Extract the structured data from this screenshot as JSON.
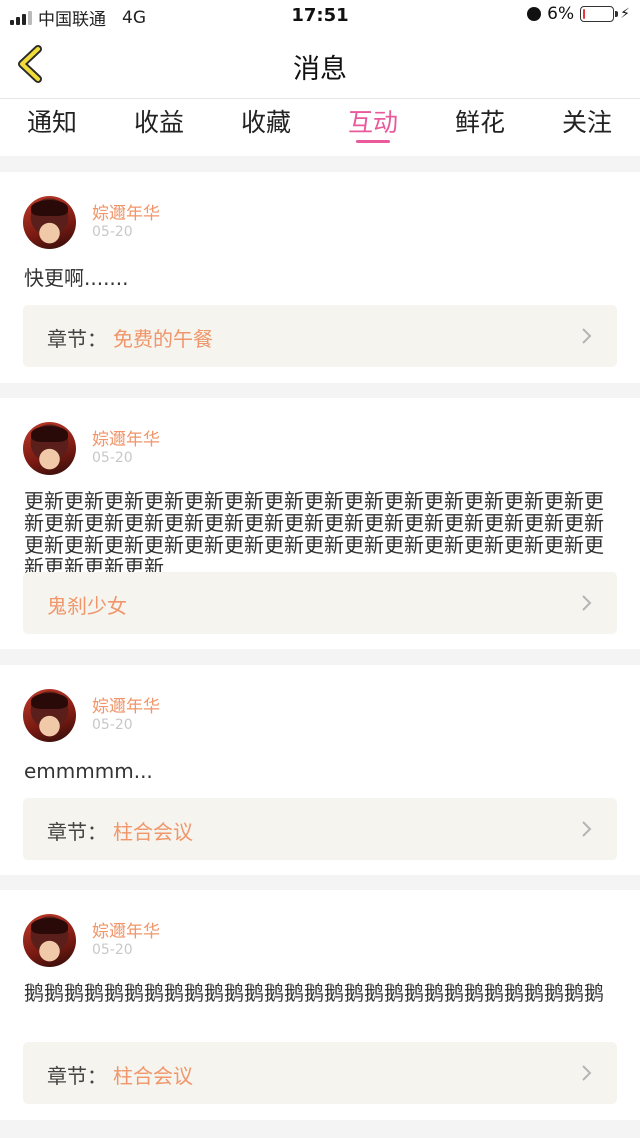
{
  "status_bar": {
    "carrier": "中国联通",
    "network": "4G",
    "time": "17:51",
    "battery": "6%",
    "battery_level": 0.06
  },
  "nav": {
    "title": "消息"
  },
  "tabs": [
    {
      "label": "通知"
    },
    {
      "label": "收益"
    },
    {
      "label": "收藏"
    },
    {
      "label": "互动",
      "active": true
    },
    {
      "label": "鲜花"
    },
    {
      "label": "关注"
    }
  ],
  "posts": [
    {
      "user": "婃邇年华",
      "date": "05-20",
      "comment": "快更啊.......",
      "ref_prefix": "章节：",
      "ref_title": "免费的午餐"
    },
    {
      "user": "婃邇年华",
      "date": "05-20",
      "comment": "更新更新更新更新更新更新更新更新更新更新更新更新更新更新更新更新更新更新更新更新更新更新更新更新更新更新更新更新更新更新更新更新更新更新更新更新更新更新更新更新更新更新更新更新更新更新更新",
      "ref_prefix": "",
      "ref_title": "鬼刹少女"
    },
    {
      "user": "婃邇年华",
      "date": "05-20",
      "comment": "emmmmm...",
      "ref_prefix": "章节：",
      "ref_title": "柱合会议"
    },
    {
      "user": "婃邇年华",
      "date": "05-20",
      "comment": "鹅鹅鹅鹅鹅鹅鹅鹅鹅鹅鹅鹅鹅鹅鹅鹅鹅鹅鹅鹅鹅鹅鹅鹅鹅鹅鹅鹅鹅",
      "ref_prefix": "章节：",
      "ref_title": "柱合会议"
    }
  ],
  "colors": {
    "accent": "#e85a9b",
    "username": "#f0966a",
    "background": "#f4f4f4",
    "ref_box": "#f5f4ee"
  }
}
